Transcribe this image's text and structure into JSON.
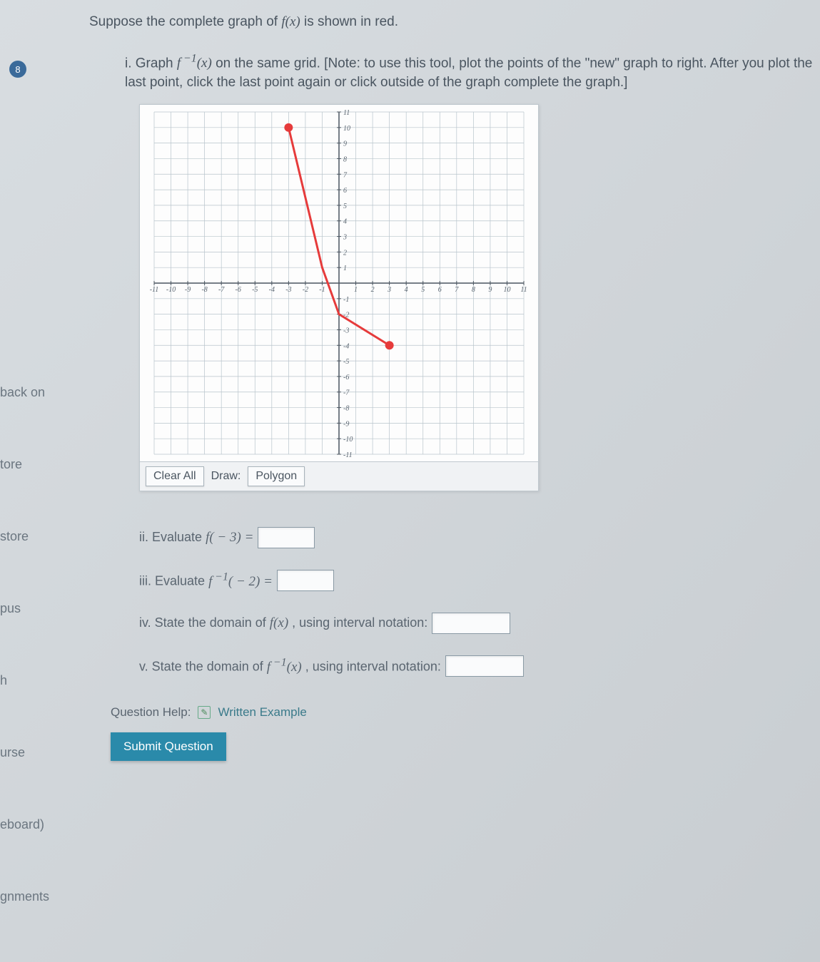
{
  "sidebar": {
    "items": [
      "back on",
      "tore",
      "store",
      "pus",
      "h",
      "urse",
      "eboard)",
      "gnments"
    ]
  },
  "question": {
    "number": "8",
    "intro_html": "Suppose the complete graph of  f(x)  is shown in red.",
    "part_i_html": "i. Graph  f⁻¹(x)  on the same grid. [Note: to use this tool, plot the points of the \"new\" graph to right. After you plot the last point, click the last point again or click outside of the graph complete the graph.]",
    "parts": {
      "ii": "ii. Evaluate  f( − 3) =",
      "iii": "iii. Evaluate  f⁻¹( − 2) =",
      "iv_pre": "iv. State the domain of  f(x) , using interval notation:",
      "v_pre": "v. State the domain of  f⁻¹(x) , using interval notation:"
    },
    "help_label": "Question Help:",
    "help_link": "Written Example",
    "submit_label": "Submit Question"
  },
  "toolbar": {
    "clear": "Clear All",
    "draw_label": "Draw:",
    "tool": "Polygon"
  },
  "chart_data": {
    "type": "line",
    "title": "",
    "xlabel": "",
    "ylabel": "",
    "xlim": [
      -11,
      11
    ],
    "ylim": [
      -11,
      11
    ],
    "x_ticks": [
      -11,
      -10,
      -9,
      -8,
      -7,
      -6,
      -5,
      -4,
      -3,
      -2,
      -1,
      1,
      2,
      3,
      4,
      5,
      6,
      7,
      8,
      9,
      10,
      11
    ],
    "y_ticks": [
      -11,
      -10,
      -9,
      -8,
      -7,
      -6,
      -5,
      -4,
      -3,
      -2,
      -1,
      1,
      2,
      3,
      4,
      5,
      6,
      7,
      8,
      9,
      10,
      11
    ],
    "series": [
      {
        "name": "f(x)",
        "color": "#e63b3b",
        "points": [
          {
            "x": -3,
            "y": 10
          },
          {
            "x": -1,
            "y": 1
          },
          {
            "x": 0,
            "y": -2
          },
          {
            "x": 3,
            "y": -4
          }
        ],
        "closed_endpoints": [
          {
            "x": -3,
            "y": 10
          },
          {
            "x": 3,
            "y": -4
          }
        ]
      }
    ]
  }
}
